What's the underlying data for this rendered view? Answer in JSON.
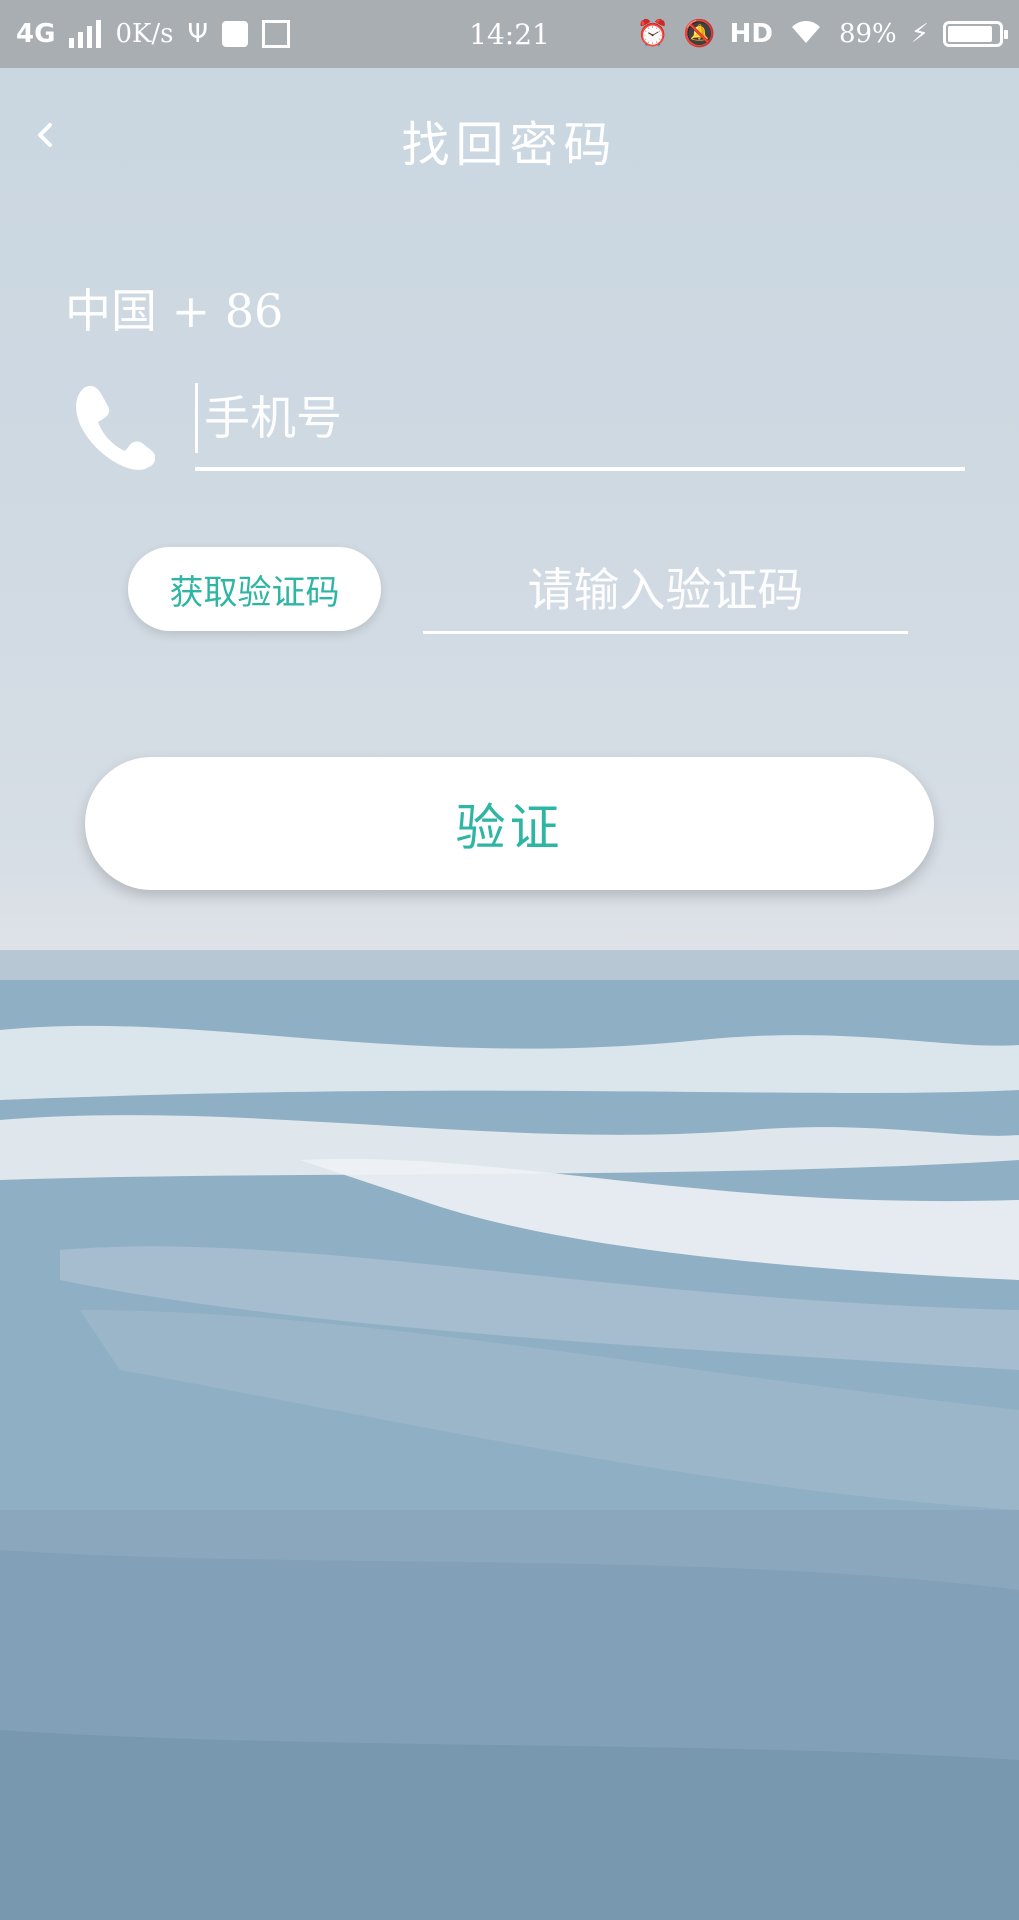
{
  "status_bar": {
    "network": "4G",
    "speed": "0K/s",
    "time": "14:21",
    "hd": "HD",
    "battery_percent": "89%",
    "battery_level": 0.89
  },
  "header": {
    "back_icon": "chevron-left-icon",
    "title": "找回密码"
  },
  "form": {
    "country_code": "中国 + 86",
    "phone_icon": "phone-icon",
    "phone_placeholder": "手机号",
    "get_code_label": "获取验证码",
    "code_placeholder": "请输入验证码",
    "verify_label": "验证"
  },
  "colors": {
    "accent": "#2fb5a4",
    "status_bar_bg": "#a9aeb3"
  }
}
